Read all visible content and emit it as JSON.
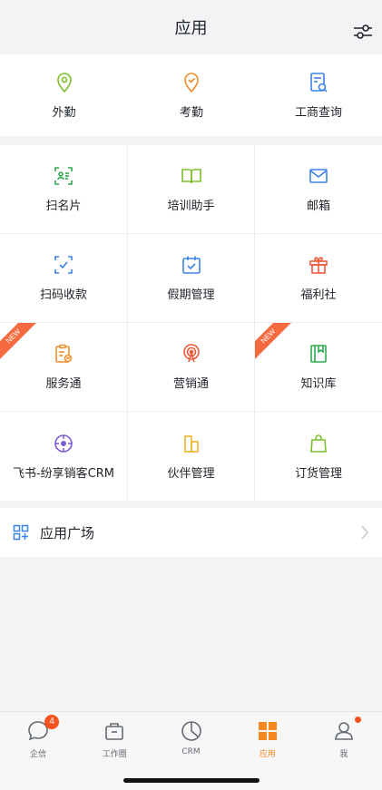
{
  "header": {
    "title": "应用"
  },
  "top_apps": [
    {
      "label": "外勤",
      "icon": "location-pin-icon",
      "color": "#7cbf2a"
    },
    {
      "label": "考勤",
      "icon": "attendance-check-icon",
      "color": "#f18d2b"
    },
    {
      "label": "工商查询",
      "icon": "business-query-icon",
      "color": "#3b82e6"
    }
  ],
  "apps": [
    {
      "label": "扫名片",
      "icon": "scan-card-icon",
      "color": "#2fa84f",
      "badge": ""
    },
    {
      "label": "培训助手",
      "icon": "book-icon",
      "color": "#7cbf2a",
      "badge": ""
    },
    {
      "label": "邮箱",
      "icon": "mail-icon",
      "color": "#3b82e6",
      "badge": ""
    },
    {
      "label": "扫码收款",
      "icon": "scan-pay-icon",
      "color": "#3b82e6",
      "badge": ""
    },
    {
      "label": "假期管理",
      "icon": "calendar-check-icon",
      "color": "#3b82e6",
      "badge": ""
    },
    {
      "label": "福利社",
      "icon": "gift-icon",
      "color": "#f05a3c",
      "badge": ""
    },
    {
      "label": "服务通",
      "icon": "service-clipboard-icon",
      "color": "#f18d2b",
      "badge": "NEW"
    },
    {
      "label": "营销通",
      "icon": "broadcast-icon",
      "color": "#f05a3c",
      "badge": ""
    },
    {
      "label": "知识库",
      "icon": "knowledge-book-icon",
      "color": "#2fa84f",
      "badge": "NEW"
    },
    {
      "label": "飞书-纷享销客CRM",
      "icon": "crosshair-icon",
      "color": "#7b5cd6",
      "badge": ""
    },
    {
      "label": "伙伴管理",
      "icon": "partner-buildings-icon",
      "color": "#f0b429",
      "badge": ""
    },
    {
      "label": "订货管理",
      "icon": "shopping-bag-icon",
      "color": "#7cbf2a",
      "badge": ""
    }
  ],
  "plaza": {
    "label": "应用广场",
    "icon": "app-plaza-icon"
  },
  "tabbar": [
    {
      "label": "企信",
      "icon": "chat-bubble-icon",
      "badge": "4"
    },
    {
      "label": "工作圈",
      "icon": "briefcase-icon",
      "badge": ""
    },
    {
      "label": "CRM",
      "icon": "pie-clock-icon",
      "badge": ""
    },
    {
      "label": "应用",
      "icon": "grid-apps-icon",
      "badge": ""
    },
    {
      "label": "我",
      "icon": "person-icon",
      "badge": ""
    }
  ],
  "colors": {
    "accent": "#f5891f",
    "badge": "#f5521f",
    "ribbon": "#f56a3f"
  }
}
